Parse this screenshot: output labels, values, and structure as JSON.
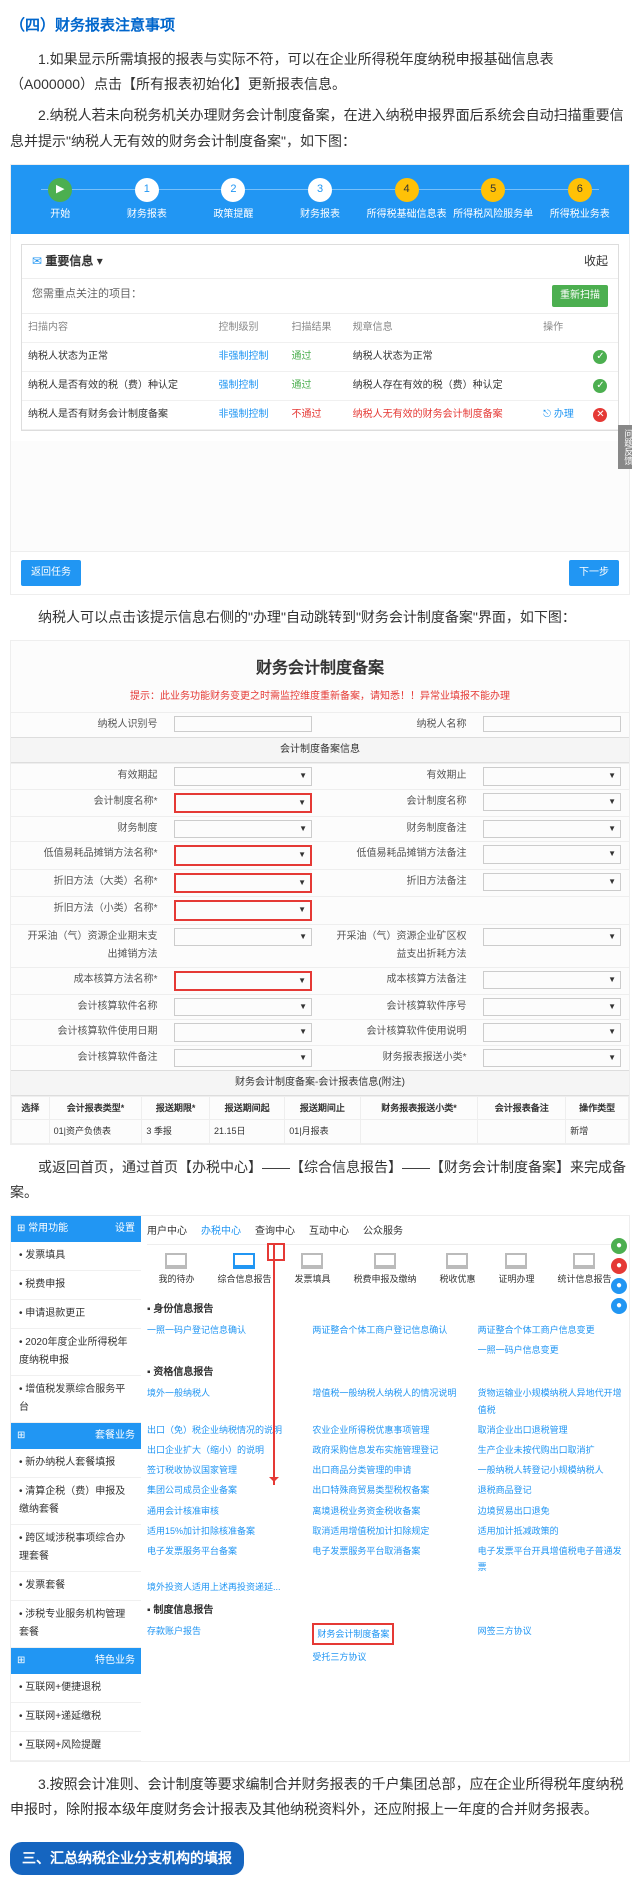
{
  "headings": {
    "s4": "（四）财务报表注意事项",
    "s3_next": "三、汇总纳税企业分支机构的填报"
  },
  "paras": {
    "p1": "1.如果显示所需填报的报表与实际不符，可以在企业所得税年度纳税申报基础信息表（A000000）点击【所有报表初始化】更新报表信息。",
    "p2": "2.纳税人若未向税务机关办理财务会计制度备案，在进入纳税申报界面后系统会自动扫描重要信息并提示\"纳税人无有效的财务会计制度备案\"，如下图：",
    "p3": "纳税人可以点击该提示信息右侧的\"办理\"自动跳转到\"财务会计制度备案\"界面，如下图：",
    "p4": "或返回首页，通过首页【办税中心】——【综合信息报告】——【财务会计制度备案】来完成备案。",
    "p5": "3.按照会计准则、会计制度等要求编制合并财务报表的千户集团总部，应在企业所得税年度纳税申报时，除附报本级年度财务会计报表及其他纳税资料外，还应附报上一年度的合并财务报表。"
  },
  "fig1": {
    "steps": [
      "开始",
      "财务报表",
      "政策提醒",
      "财务报表",
      "所得税基础信息表",
      "所得税风险服务单",
      "所得税业务表"
    ],
    "imp_title": "重要信息",
    "imp_collapse": "收起",
    "imp_sub_l": "您需重点关注的项目：",
    "imp_btn": "重新扫描",
    "cols": [
      "扫描内容",
      "控制级别",
      "扫描结果",
      "规章信息",
      "操作"
    ],
    "rows": [
      {
        "c0": "纳税人状态为正常",
        "c1": "非强制控制",
        "c2": "通过",
        "c3": "纳税人状态为正常",
        "dot": "g"
      },
      {
        "c0": "纳税人是否有效的税（费）种认定",
        "c1": "强制控制",
        "c2": "通过",
        "c3": "纳税人存在有效的税（费）种认定",
        "dot": "g"
      },
      {
        "c0": "纳税人是否有财务会计制度备案",
        "c1": "非强制控制",
        "c2": "不通过",
        "c3": "纳税人无有效的财务会计制度备案",
        "op": "办理",
        "dot": "r"
      }
    ],
    "foot_l": "返回任务",
    "foot_r": "下一步",
    "side": "问题反馈"
  },
  "fig2": {
    "title": "财务会计制度备案",
    "warn": "提示：此业务功能财务变更之时需监控维度重新备案，请知悉！！异常业填报不能办理",
    "head_l": "纳税人识别号",
    "head_r": "纳税人名称",
    "band1": "会计制度备案信息",
    "left_labels": [
      "有效期起",
      "会计制度名称*",
      "财务制度",
      "低值易耗品摊销方法名称*",
      "折旧方法（大类）名称*",
      "折旧方法（小类）名称*",
      "开采油（气）资源企业期末支出摊销方法",
      "成本核算方法名称*",
      "会计核算软件名称",
      "会计核算软件使用日期",
      "会计核算软件备注"
    ],
    "right_labels": [
      "有效期止",
      "会计制度名称",
      "财务制度备注",
      "低值易耗品摊销方法备注",
      "折旧方法备注",
      "",
      "开采油（气）资源企业矿区权益支出折耗方法",
      "成本核算方法备注",
      "会计核算软件序号",
      "会计核算软件使用说明",
      "财务报表报送小类*"
    ],
    "band2": "财务会计制度备案-会计报表信息(附注)",
    "tbl_head": [
      "选择",
      "会计报表类型*",
      "报送期限*",
      "报送期间起",
      "报送期间止",
      "财务报表报送小类*",
      "会计报表备注",
      "操作类型"
    ],
    "tbl_row": [
      "",
      "01|资产负债表",
      "3 季报",
      "21.15日",
      "01|月报表",
      "",
      "",
      "新增"
    ]
  },
  "fig3": {
    "side_h1": "常用功能",
    "side_set": "设置",
    "side_items1": [
      "发票填具",
      "税费申报",
      "申请退款更正",
      "2020年度企业所得税年度纳税申报",
      "增值税发票综合服务平台"
    ],
    "side_h2": "套餐业务",
    "side_items2": [
      "新办纳税人套餐填报",
      "清算企税（费）申报及缴纳套餐",
      "跨区域涉税事项综合办理套餐",
      "发票套餐",
      "涉税专业服务机构管理套餐"
    ],
    "side_h3": "特色业务",
    "side_items3": [
      "互联网+便捷退税",
      "互联网+递延缴税",
      "互联网+风险提醒"
    ],
    "tabs": [
      "用户中心",
      "办税中心",
      "查询中心",
      "互动中心",
      "公众服务"
    ],
    "icons": [
      "我的待办",
      "综合信息报告",
      "发票填具",
      "税费申报及缴纳",
      "税收优惠",
      "证明办理",
      "统计信息报告"
    ],
    "sec1_h": "身份信息报告",
    "sec1": [
      "一照一码户登记信息确认",
      "两证整合个体工商户登记信息确认",
      "两证整合个体工商户信息变更"
    ],
    "sec1b": [
      "",
      "",
      "一照一码户信息变更"
    ],
    "sec2_h": "资格信息报告",
    "sec2": [
      "境外一般纳税人",
      "增值税一般纳税人纳税人的情况说明",
      "货物运输业小规模纳税人异地代开增值税",
      "出口（免）税企业纳税情况的说明",
      "农业企业所得税优惠事项管理",
      "取消企业出口退税管理",
      "出口企业扩大（缩小）的说明",
      "政府采购信息发布实施管理登记",
      "生产企业未按代购出口取消扩",
      "签订税收协议国家管理",
      "出口商品分类管理的申请",
      "一般纳税人转登记小规模纳税人",
      "集团公司成员企业备案",
      "出口特殊商贸易类型税权备案",
      "退税商品登记",
      "通用会计核准审核",
      "离境退税业务资金税收备案",
      "边境贸易出口退免",
      "适用15%加计扣除核准备案",
      "取消适用增值税加计扣除规定",
      "适用加计抵减政策的",
      "电子发票服务平台备案",
      "电子发票服务平台取消备案",
      "电子发票平台开具增值税电子普通发票",
      "境外投资人适用上述再投资递延..."
    ],
    "sec3_h": "制度信息报告",
    "sec3": [
      "存款账户报告",
      "财务会计制度备案"
    ],
    "sec3b": [
      "网签三方协议",
      "",
      "受托三方协议"
    ]
  }
}
